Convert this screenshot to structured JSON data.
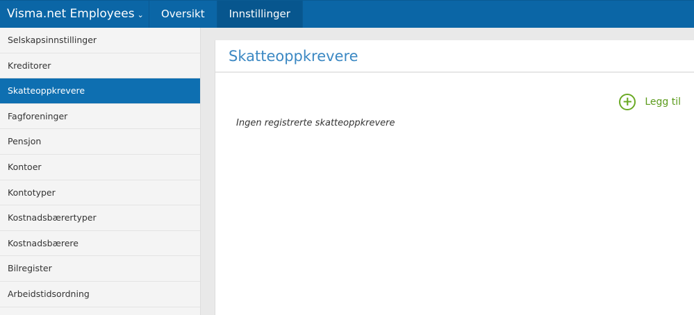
{
  "header": {
    "app_title": "Visma.net Employees",
    "tabs": [
      {
        "label": "Oversikt"
      },
      {
        "label": "Innstillinger"
      }
    ]
  },
  "sidebar": {
    "items": [
      {
        "label": "Selskapsinnstillinger"
      },
      {
        "label": "Kreditorer"
      },
      {
        "label": "Skatteoppkrevere"
      },
      {
        "label": "Fagforeninger"
      },
      {
        "label": "Pensjon"
      },
      {
        "label": "Kontoer"
      },
      {
        "label": "Kontotyper"
      },
      {
        "label": "Kostnadsbærertyper"
      },
      {
        "label": "Kostnadsbærere"
      },
      {
        "label": "Bilregister"
      },
      {
        "label": "Arbeidstidsordning"
      }
    ],
    "active_index": 2
  },
  "main": {
    "title": "Skatteoppkrevere",
    "add_label": "Legg til",
    "empty_text": "Ingen registrerte skatteoppkrevere"
  },
  "colors": {
    "topbar": "#0b66a6",
    "active": "#0e6fb1",
    "title": "#3b88c3",
    "add": "#6aa923"
  }
}
